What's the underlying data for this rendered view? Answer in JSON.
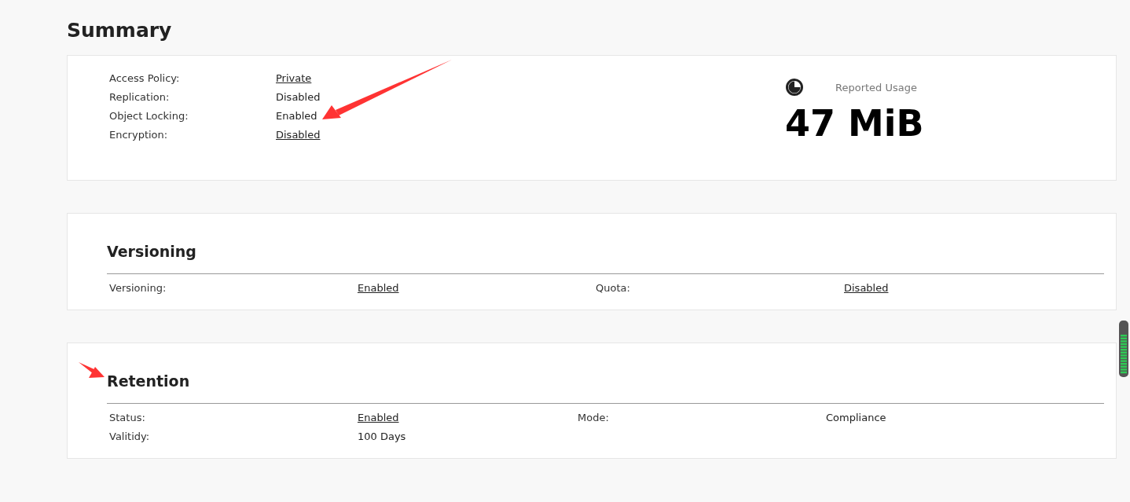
{
  "title": "Summary",
  "summary": {
    "rows": [
      {
        "label": "Access Policy:",
        "value": "Private",
        "link": true
      },
      {
        "label": "Replication:",
        "value": "Disabled",
        "link": false
      },
      {
        "label": "Object Locking:",
        "value": "Enabled",
        "link": false
      },
      {
        "label": "Encryption:",
        "value": "Disabled",
        "link": true
      }
    ],
    "usage": {
      "label": "Reported Usage",
      "value": "47 MiB"
    }
  },
  "sections": [
    {
      "heading": "Versioning",
      "rows": [
        [
          {
            "label": "Versioning:",
            "value": "Enabled",
            "link": true
          },
          {
            "label": "Quota:",
            "value": "Disabled",
            "link": true
          }
        ]
      ]
    },
    {
      "heading": "Retention",
      "rows": [
        [
          {
            "label": "Status:",
            "value": "Enabled",
            "link": true
          },
          {
            "label": "Mode:",
            "value": "Compliance",
            "link": false
          }
        ],
        [
          {
            "label": "Valitidy:",
            "value": "100 Days",
            "link": false
          }
        ]
      ]
    }
  ]
}
